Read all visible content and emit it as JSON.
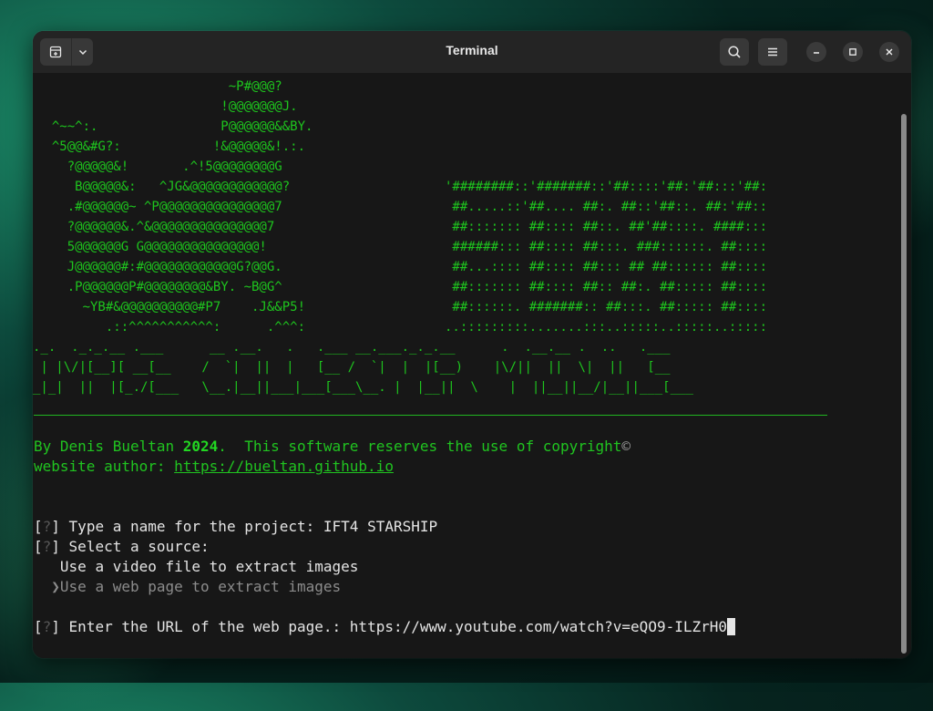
{
  "window": {
    "title": "Terminal"
  },
  "titlebar": {
    "new_tab_icon": "new-tab-icon",
    "dropdown_icon": "chevron-down-icon",
    "search_icon": "search-icon",
    "menu_icon": "hamburger-icon",
    "minimize_icon": "minimize-icon",
    "maximize_icon": "maximize-icon",
    "close_icon": "close-icon"
  },
  "ascii": {
    "logo_lines": [
      "                         ~P#@@@?",
      "                        !@@@@@@@J.",
      "  ^~~^:.                P@@@@@@&&BY.",
      "  ^5@@&#G?:            !&@@@@@&!.:.",
      "    ?@@@@@&!       .^!5@@@@@@@@G",
      "     B@@@@@&:   ^JG&@@@@@@@@@@@@?",
      "    .#@@@@@@~ ^P@@@@@@@@@@@@@@@7",
      "    ?@@@@@@&.^&@@@@@@@@@@@@@@@7",
      "    5@@@@@@G G@@@@@@@@@@@@@@@!",
      "    J@@@@@@#:#@@@@@@@@@@@@G?@@G.",
      "    .P@@@@@@P#@@@@@@@@&BY. ~B@G^",
      "      ~YB#&@@@@@@@@@@#P7    .J&&P5!",
      "         .::^^^^^^^^^^^:      .^^^:"
    ],
    "side_lines": [
      "'########::'#######::'##::::'##:'##:::'##:",
      " ##.....::'##.... ##:. ##::'##::. ##:'##::",
      " ##::::::: ##:::: ##::. ##'##::::. ####:::",
      " ######::: ##:::: ##:::. ###::::::. ##::::",
      " ##...:::: ##:::: ##::: ## ##:::::: ##::::",
      " ##::::::: ##:::: ##:: ##:. ##::::: ##::::",
      " ##::::::. #######:: ##:::. ##::::: ##::::",
      "..:::::::::.......:::..:::::..:::::..:::::"
    ],
    "banner_lines": [
      "._.  ._._.__ .___      __ .__.   .   .___ __.___._._.__      .  .__.__ .  ..   .___",
      " | |\\/|[__][ __[__    /  `|  ||  |   [__ /  `|  |  |[__)    |\\/||  ||  \\|  ||   [__",
      "_|_|  ||  |[_./[___   \\__.|__||___|___[___\\__. |  |__||  \\    |  ||__||__/|__||___[___"
    ]
  },
  "output": {
    "credit_prefix": "By Denis Bueltan ",
    "credit_year": "2024",
    "credit_suffix": ".  This software reserves the use of copyright",
    "copyright_symbol": "©",
    "website_label": "website author: ",
    "website_url": "https://bueltan.github.io"
  },
  "prompts": [
    {
      "marker": "?",
      "question": "Type a name for the project: ",
      "answer": "IFT4 STARSHIP"
    },
    {
      "marker": "?",
      "question": "Select a source:"
    }
  ],
  "source_options": [
    {
      "label": "Use a video file to extract images",
      "selected": false
    },
    {
      "label": "Use a web page to extract images",
      "selected": true,
      "pointer": "❯"
    }
  ],
  "url_prompt": {
    "marker": "?",
    "question": "Enter the URL of the web page.: ",
    "value": "https://www.youtube.com/watch?v=eQO9-ILZrH0"
  },
  "colors": {
    "accent_green": "#20c420",
    "terminal_bg": "#171717",
    "titlebar_bg": "#242424",
    "text": "#e4e4e4"
  }
}
